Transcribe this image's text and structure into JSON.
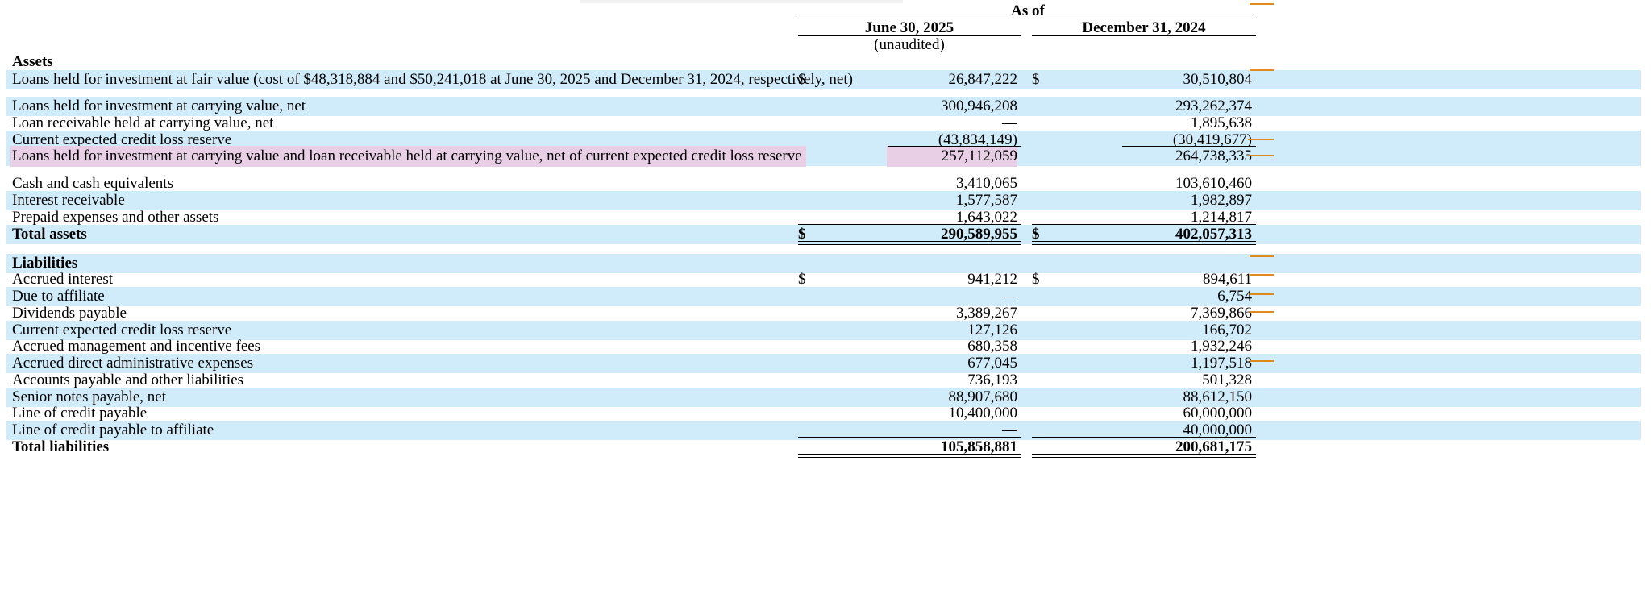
{
  "header": {
    "as_of": "As of",
    "col1_date": "June 30, 2025",
    "col1_note": "(unaudited)",
    "col2_date": "December 31, 2024"
  },
  "colors": {
    "band": "#d0ebf9",
    "highlight": "#e8cfe6",
    "marker": "#e08a1e"
  },
  "rows": [
    {
      "label": "Assets",
      "bold": true,
      "band": false
    },
    {
      "label": "Loans held for investment at fair value (cost of $48,318,884 and $50,241,018 at June 30, 2025 and December 31, 2024, respectively, net)",
      "d1": "$",
      "v1": "26,847,222",
      "d2": "$",
      "v2": "30,510,804",
      "band": true
    },
    {
      "label": "Loans held for investment at carrying value, net",
      "v1": "300,946,208",
      "v2": "293,262,374",
      "band": true
    },
    {
      "label": "Loan receivable held at carrying value, net",
      "v1": "—",
      "v2": "1,895,638",
      "band": false
    },
    {
      "label": "Current expected credit loss reserve",
      "v1": "(43,834,149)",
      "v2": "(30,419,677)",
      "band": true
    },
    {
      "label": "Loans held for investment at carrying value and loan receivable held at carrying value, net of current expected credit loss reserve",
      "v1": "257,112,059",
      "v2": "264,738,335",
      "band": true,
      "highlight": true
    },
    {
      "label": "Cash and cash equivalents",
      "v1": "3,410,065",
      "v2": "103,610,460",
      "band": false
    },
    {
      "label": "Interest receivable",
      "v1": "1,577,587",
      "v2": "1,982,897",
      "band": true
    },
    {
      "label": "Prepaid expenses and other assets",
      "v1": "1,643,022",
      "v2": "1,214,817",
      "band": false
    },
    {
      "label": "Total assets",
      "d1": "$",
      "v1": "290,589,955",
      "d2": "$",
      "v2": "402,057,313",
      "bold": true,
      "band": true
    },
    {
      "label": "Liabilities",
      "bold": true,
      "band": true
    },
    {
      "label": "Accrued interest",
      "d1": "$",
      "v1": "941,212",
      "d2": "$",
      "v2": "894,611",
      "band": false
    },
    {
      "label": "Due to affiliate",
      "v1": "—",
      "v2": "6,754",
      "band": true
    },
    {
      "label": "Dividends payable",
      "v1": "3,389,267",
      "v2": "7,369,866",
      "band": false
    },
    {
      "label": "Current expected credit loss reserve",
      "v1": "127,126",
      "v2": "166,702",
      "band": true
    },
    {
      "label": "Accrued management and incentive fees",
      "v1": "680,358",
      "v2": "1,932,246",
      "band": false
    },
    {
      "label": "Accrued direct administrative expenses",
      "v1": "677,045",
      "v2": "1,197,518",
      "band": true
    },
    {
      "label": "Accounts payable and other liabilities",
      "v1": "736,193",
      "v2": "501,328",
      "band": false
    },
    {
      "label": "Senior notes payable, net",
      "v1": "88,907,680",
      "v2": "88,612,150",
      "band": true
    },
    {
      "label": "Line of credit payable",
      "v1": "10,400,000",
      "v2": "60,000,000",
      "band": false
    },
    {
      "label": "Line of credit payable to affiliate",
      "v1": "—",
      "v2": "40,000,000",
      "band": true
    },
    {
      "label": "Total liabilities",
      "v1": "105,858,881",
      "v2": "200,681,175",
      "bold": true,
      "band": false
    }
  ]
}
